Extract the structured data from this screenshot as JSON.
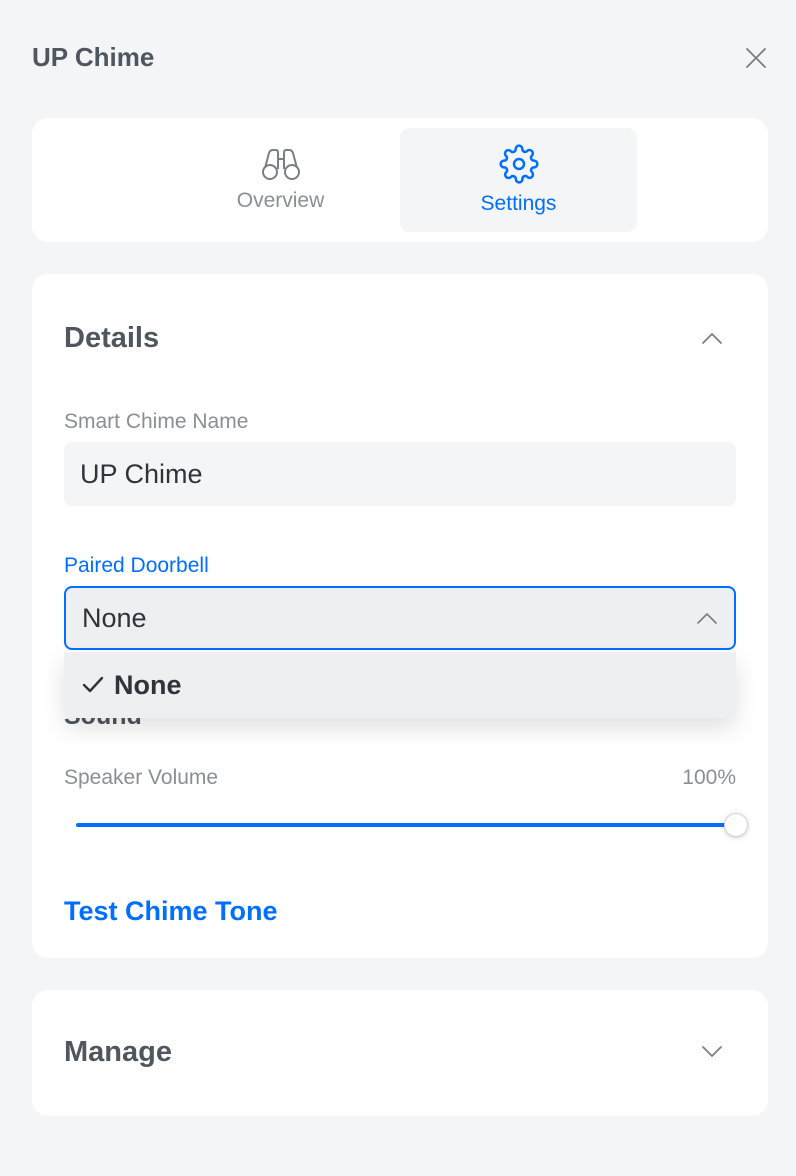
{
  "header": {
    "title": "UP Chime"
  },
  "tabs": [
    {
      "id": "overview",
      "label": "Overview",
      "icon": "binoculars-icon",
      "active": false
    },
    {
      "id": "settings",
      "label": "Settings",
      "icon": "gear-icon",
      "active": true
    }
  ],
  "details": {
    "title": "Details",
    "name_label": "Smart Chime Name",
    "name_value": "UP Chime",
    "doorbell_label": "Paired Doorbell",
    "doorbell_value": "None",
    "doorbell_options": [
      {
        "label": "None",
        "selected": true
      }
    ],
    "sound_title": "Sound",
    "volume_label": "Speaker Volume",
    "volume_text": "100%",
    "volume_level": 1.0,
    "test_label": "Test Chime Tone"
  },
  "manage": {
    "title": "Manage"
  },
  "colors": {
    "accent": "#006fff",
    "background": "#f4f5f6",
    "text": "#50565e",
    "muted": "#8a8f96"
  }
}
